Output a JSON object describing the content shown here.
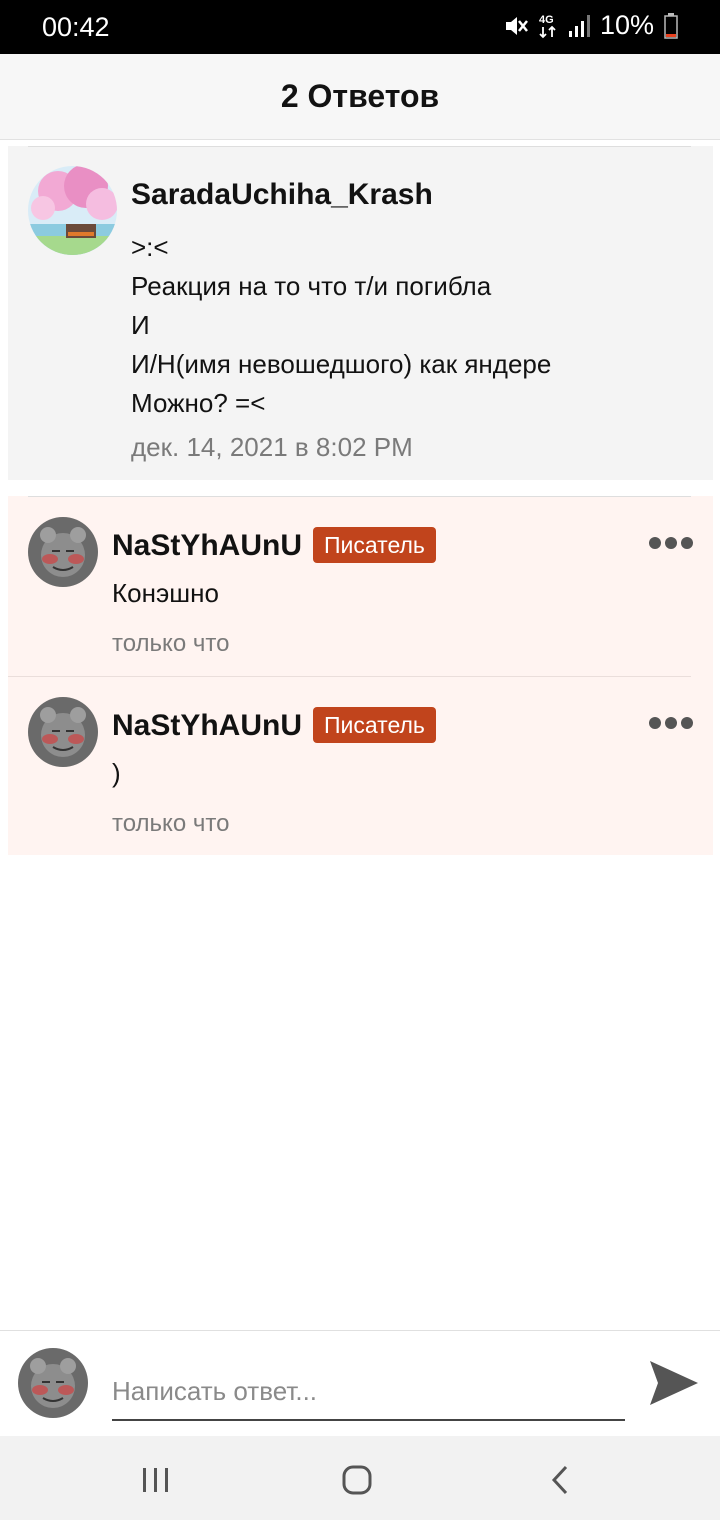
{
  "status_bar": {
    "time": "00:42",
    "battery": "10%"
  },
  "header": {
    "title": "2 Ответов"
  },
  "original_comment": {
    "author": "SaradaUchiha_Krash",
    "lines": [
      ">:<",
      "Реакция на то что т/и погибла",
      "И",
      "И/Н(имя невошедшого) как яндере",
      "Можно? =<"
    ],
    "date": "дек. 14, 2021 в 8:02 PM"
  },
  "replies": [
    {
      "author": "NaStYhAUnU",
      "badge": "Писатель",
      "text": "Конэшно",
      "time": "только что"
    },
    {
      "author": "NaStYhAUnU",
      "badge": "Писатель",
      "text": ")",
      "time": "только что"
    }
  ],
  "composer": {
    "placeholder": "Написать ответ..."
  },
  "colors": {
    "badge": "#c1441c",
    "reply_background": "#fff4f1",
    "original_background": "#f4f4f4"
  },
  "icons": {
    "status": [
      "mute-icon",
      "4g-icon",
      "signal-icon",
      "battery-icon"
    ],
    "reply_more": "more-dots-icon",
    "send": "send-icon",
    "nav": [
      "recents-icon",
      "home-icon",
      "back-icon"
    ]
  }
}
